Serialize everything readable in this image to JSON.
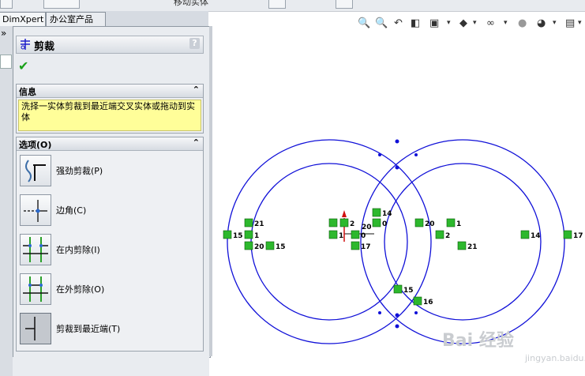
{
  "tabs": [
    {
      "label": "DimXpert"
    },
    {
      "label": "办公室产品"
    }
  ],
  "top_cut_text": "移动实体",
  "property_manager": {
    "title": "剪裁",
    "help": "?",
    "info": {
      "header": "信息",
      "text": "洗择一实体剪裁到最近端交叉实体或拖动到实体"
    },
    "options": {
      "header": "选项(O)",
      "items": [
        {
          "label": "强劲剪裁(P)"
        },
        {
          "label": "边角(C)"
        },
        {
          "label": "在内剪除(I)"
        },
        {
          "label": "在外剪除(O)"
        },
        {
          "label": "剪裁到最近端(T)"
        }
      ]
    }
  },
  "sketch_labels": [
    {
      "text": "21"
    },
    {
      "text": "15"
    },
    {
      "text": "1"
    },
    {
      "text": "20"
    },
    {
      "text": "15"
    },
    {
      "text": "2"
    },
    {
      "text": "20"
    },
    {
      "text": "1"
    },
    {
      "text": "0"
    },
    {
      "text": "17"
    },
    {
      "text": "14"
    },
    {
      "text": "0"
    },
    {
      "text": "20"
    },
    {
      "text": "1"
    },
    {
      "text": "2"
    },
    {
      "text": "21"
    },
    {
      "text": "14"
    },
    {
      "text": "17"
    },
    {
      "text": "15"
    },
    {
      "text": "16"
    }
  ],
  "watermark": {
    "text": "Bai 经验",
    "sub": "jingyan.baidu.com"
  },
  "colors": {
    "sketch": "#1010d8",
    "relation": "#2db82d",
    "panel": "#e9ecf0",
    "info_bg": "#fffe99"
  }
}
